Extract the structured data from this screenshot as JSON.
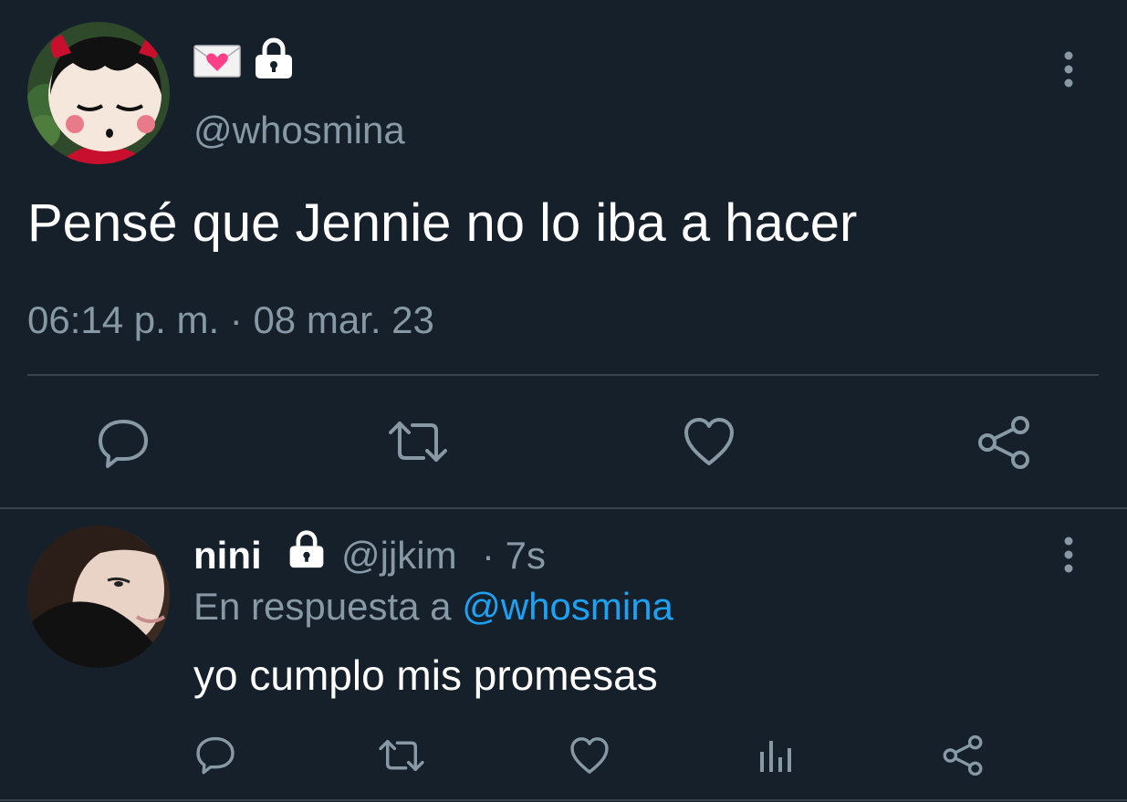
{
  "main_tweet": {
    "display_emoji": "💌",
    "handle": "@whosmina",
    "text": "Pensé que Jennie no lo iba a hacer",
    "timestamp": "06:14 p. m. · 08 mar. 23",
    "actions": [
      "reply",
      "retweet",
      "like",
      "share"
    ]
  },
  "reply": {
    "name": "nini",
    "handle": "@jjkim",
    "time": "· 7s",
    "reply_prefix": "En respuesta a",
    "reply_to": "@whosmina",
    "text": "yo cumplo mis promesas",
    "actions": [
      "reply",
      "retweet",
      "like",
      "views",
      "share"
    ]
  },
  "colors": {
    "background": "#15202b",
    "muted": "#8899a6",
    "link": "#1da1f2",
    "divider": "#38444d"
  }
}
